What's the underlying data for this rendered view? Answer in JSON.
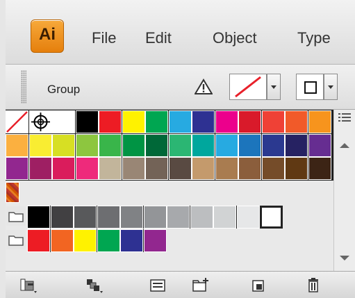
{
  "menubar": {
    "app_logo": "Ai",
    "items": [
      "File",
      "Edit",
      "Object",
      "Type"
    ]
  },
  "controlbar": {
    "selection_label": "Group",
    "warning_icon": "warning-triangle-icon",
    "fill_swatch": "none",
    "stroke_swatch": "black-square"
  },
  "swatches": {
    "row1": [
      "none",
      "registration",
      "#ffffff",
      "#000000",
      "#ed1c24",
      "#fff200",
      "#00a651",
      "#27aae1",
      "#2e3192",
      "#ec008c",
      "#d91a2a",
      "#ef4136",
      "#f15a29",
      "#f7941d"
    ],
    "row2": [
      "#fbb040",
      "#f9ed32",
      "#d7df23",
      "#8dc63f",
      "#39b54a",
      "#009444",
      "#006838",
      "#2bb673",
      "#00a79d",
      "#27aae1",
      "#1c75bc",
      "#2b3990",
      "#262262",
      "#662d91"
    ],
    "row3": [
      "#92278f",
      "#9e1f63",
      "#da1c5c",
      "#ee2a7b",
      "#c2b59b",
      "#998675",
      "#736357",
      "#594a42",
      "#c49a6c",
      "#a97c50",
      "#8b5e3c",
      "#754c29",
      "#603913",
      "#3c2415"
    ],
    "pattern_row": [
      "pattern"
    ],
    "gray_group": [
      "#000000",
      "#414042",
      "#58595b",
      "#6d6e71",
      "#808285",
      "#939598",
      "#a7a9ac",
      "#bcbec0",
      "#d1d3d4",
      "#e6e7e8",
      "#ffffff"
    ],
    "bright_group": [
      "#ed1c24",
      "#f26522",
      "#fff200",
      "#00a651",
      "#2e3192",
      "#92278f"
    ]
  },
  "bottombar": {
    "icons": [
      "swatch-libraries-icon",
      "show-swatch-kinds-icon",
      "swatch-options-icon",
      "new-color-group-icon",
      "new-swatch-icon",
      "delete-swatch-icon"
    ]
  }
}
